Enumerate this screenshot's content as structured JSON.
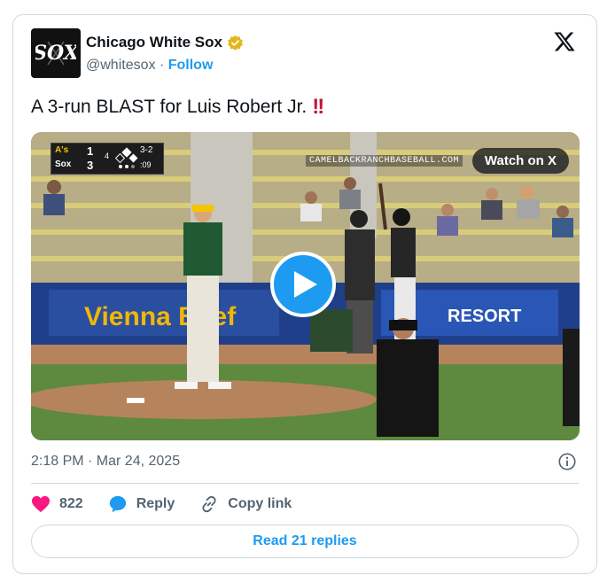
{
  "author": {
    "name": "Chicago White Sox",
    "handle": "@whitesox",
    "separator": "·",
    "follow_label": "Follow"
  },
  "tweet": {
    "text": "A 3-run BLAST for Luis Robert Jr.",
    "emoji": "!!"
  },
  "media": {
    "watch_label": "Watch on X",
    "scorebug": {
      "away_team": "A's",
      "away_score": "1",
      "home_team": "Sox",
      "home_score": "3",
      "inning": "4",
      "count": "3-2",
      "clock": ":09"
    },
    "banner_text": "CAMELBACKRANCHBASEBALL.COM",
    "ad_left": "Vienna Beef",
    "ad_right": "RESORT"
  },
  "meta": {
    "timestamp": "2:18 PM · Mar 24, 2025"
  },
  "actions": {
    "likes_count": "822",
    "reply_label": "Reply",
    "copy_link_label": "Copy link"
  },
  "replies_button": "Read 21 replies",
  "colors": {
    "accent": "#1d9bf0",
    "like": "#f91880",
    "text": "#0f1419",
    "muted": "#536471"
  }
}
